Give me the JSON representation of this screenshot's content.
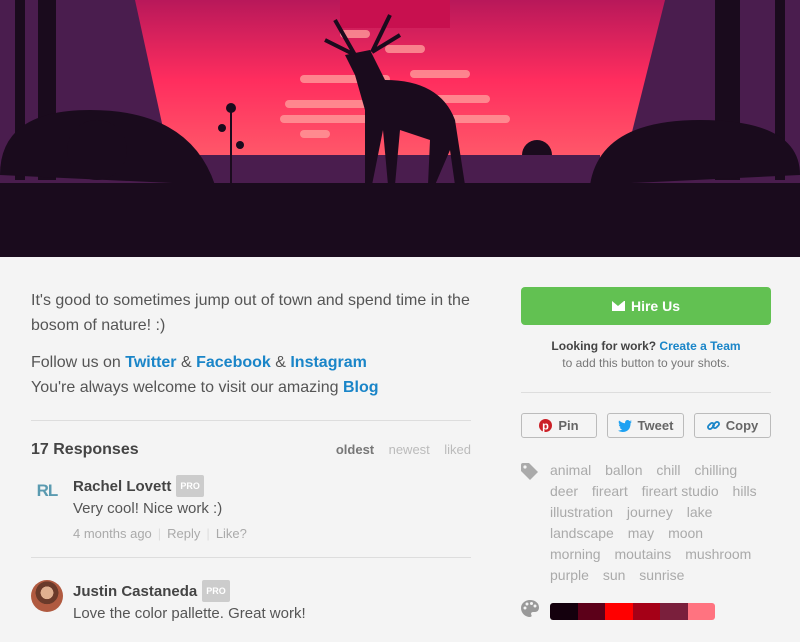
{
  "shot": {
    "alt": "deer illustration"
  },
  "description": {
    "line1": "It's good to sometimes jump out of town and spend time in the bosom of nature! :)",
    "follow_prefix": "Follow us on ",
    "twitter": "Twitter",
    "amp1": " & ",
    "facebook": "Facebook",
    "amp2": " & ",
    "instagram": "Instagram",
    "visit_prefix": "You're always welcome to visit our amazing ",
    "blog": "Blog"
  },
  "responses": {
    "title": "17 Responses",
    "sort": [
      "oldest",
      "newest",
      "liked"
    ],
    "comments": [
      {
        "name": "Rachel Lovett",
        "badge": "PRO",
        "avatar_text": "RL",
        "text": "Very cool! Nice work :)",
        "time": "4 months ago",
        "reply": "Reply",
        "like": "Like?"
      },
      {
        "name": "Justin Castaneda",
        "badge": "PRO",
        "text": "Love the color pallette. Great work!"
      }
    ]
  },
  "sidebar": {
    "hire_label": "Hire Us",
    "looking": "Looking for work?",
    "create_team": "Create a Team",
    "looking_sub": "to add this button to your shots.",
    "share": {
      "pin": "Pin",
      "tweet": "Tweet",
      "copy": "Copy"
    },
    "tags": [
      "animal",
      "ballon",
      "chill",
      "chilling",
      "deer",
      "fireart",
      "fireart studio",
      "hills",
      "illustration",
      "journey",
      "lake",
      "landscape",
      "may",
      "moon",
      "morning",
      "moutains",
      "mushroom",
      "purple",
      "sun",
      "sunrise"
    ],
    "palette": [
      "#14000d",
      "#5c0019",
      "#ff0000",
      "#a50017",
      "#7a1f3c",
      "#ff7380"
    ]
  },
  "colors": {
    "accent": "#1a85c8",
    "hire": "#62c152"
  }
}
